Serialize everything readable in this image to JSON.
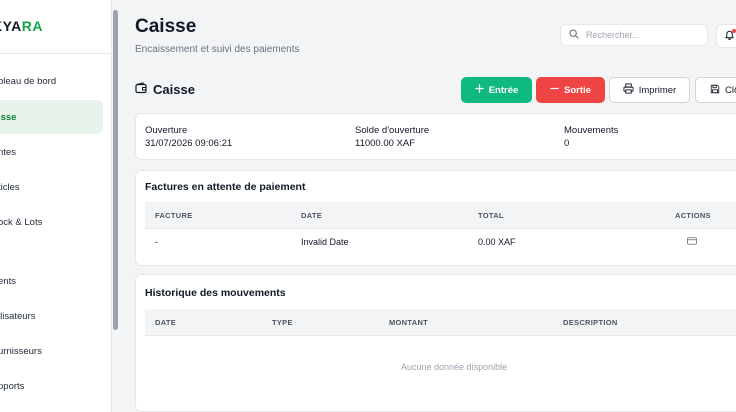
{
  "sidebar": {
    "logo_prefix": "KYA",
    "logo_accent": "RA",
    "items": [
      {
        "label": "bleau de bord"
      },
      {
        "label": "isse"
      },
      {
        "label": "ntes"
      },
      {
        "label": "ticles"
      },
      {
        "label": "ock & Lots"
      },
      {
        "label": "ents"
      },
      {
        "label": "ilisateurs"
      },
      {
        "label": "urnisseurs"
      },
      {
        "label": "pports"
      }
    ]
  },
  "header": {
    "title": "Caisse",
    "subtitle": "Encaissement et suivi des paiements",
    "search_placeholder": "Rechercher..."
  },
  "section": {
    "title": "Caisse",
    "buttons": {
      "entree": "Entrée",
      "sortie": "Sortie",
      "print": "Imprimer",
      "close": "Clô"
    }
  },
  "summary": {
    "ouverture_label": "Ouverture",
    "ouverture_value": "31/07/2026 09:06:21",
    "solde_label": "Solde d'ouverture",
    "solde_value": "11000.00 XAF",
    "mouvements_label": "Mouvements",
    "mouvements_value": "0"
  },
  "pending": {
    "title": "Factures en attente de paiement",
    "columns": [
      "FACTURE",
      "DATE",
      "TOTAL",
      "ACTIONS"
    ],
    "rows": [
      {
        "facture": "-",
        "date": "Invalid Date",
        "total": "0.00 XAF"
      }
    ]
  },
  "history": {
    "title": "Historique des mouvements",
    "columns": [
      "DATE",
      "TYPE",
      "MONTANT",
      "DESCRIPTION"
    ],
    "empty_text": "Aucune donnée disponible"
  },
  "colors": {
    "primary_green": "#10b981",
    "danger_red": "#ef4444",
    "active_nav_bg": "#e8f3ec"
  }
}
